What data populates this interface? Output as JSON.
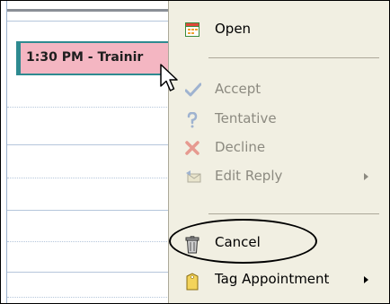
{
  "calendar": {
    "appointment_label": "1:30 PM - Trainir"
  },
  "context_menu": {
    "items": [
      {
        "label": "Open",
        "icon": "calendar-icon",
        "enabled": true
      },
      {
        "label": "Accept",
        "icon": "checkmark-icon",
        "enabled": false
      },
      {
        "label": "Tentative",
        "icon": "question-mark-icon",
        "enabled": false
      },
      {
        "label": "Decline",
        "icon": "x-mark-icon",
        "enabled": false
      },
      {
        "label": "Edit Reply",
        "icon": "edit-reply-icon",
        "enabled": false,
        "submenu": true
      },
      {
        "label": "Cancel",
        "icon": "trash-can-icon",
        "enabled": true,
        "highlighted_by_circle": true
      },
      {
        "label": "Tag Appointment",
        "icon": "tag-icon",
        "enabled": true,
        "submenu": true
      }
    ]
  },
  "colors": {
    "menu_background": "#f1efe2",
    "appointment_fill": "#f4b6c2",
    "appointment_border": "#2e8a90",
    "disabled_text": "#8c8a80"
  }
}
